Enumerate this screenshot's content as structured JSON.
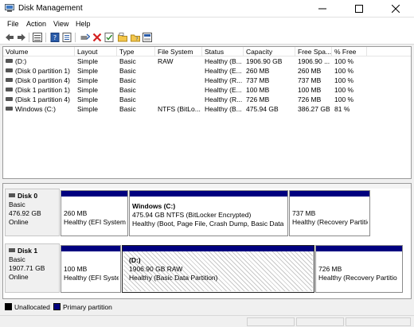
{
  "window": {
    "title": "Disk Management"
  },
  "menu": [
    "File",
    "Action",
    "View",
    "Help"
  ],
  "toolbar": {
    "icons": [
      "back-arrow-icon",
      "forward-arrow-icon",
      "list-view-icon",
      "help-book-icon",
      "properties-icon",
      "connect-icon",
      "delete-x-icon",
      "check-disk-icon",
      "new-folder-icon",
      "open-folder-icon",
      "toggle-view-icon"
    ]
  },
  "volume_list": {
    "columns": [
      "Volume",
      "Layout",
      "Type",
      "File System",
      "Status",
      "Capacity",
      "Free Spa...",
      "% Free"
    ],
    "rows": [
      [
        "(D:)",
        "Simple",
        "Basic",
        "RAW",
        "Healthy (B...",
        "1906.90 GB",
        "1906.90 ...",
        "100 %"
      ],
      [
        "(Disk 0 partition 1)",
        "Simple",
        "Basic",
        "",
        "Healthy (E...",
        "260 MB",
        "260 MB",
        "100 %"
      ],
      [
        "(Disk 0 partition 4)",
        "Simple",
        "Basic",
        "",
        "Healthy (R...",
        "737 MB",
        "737 MB",
        "100 %"
      ],
      [
        "(Disk 1 partition 1)",
        "Simple",
        "Basic",
        "",
        "Healthy (E...",
        "100 MB",
        "100 MB",
        "100 %"
      ],
      [
        "(Disk 1 partition 4)",
        "Simple",
        "Basic",
        "",
        "Healthy (R...",
        "726 MB",
        "726 MB",
        "100 %"
      ],
      [
        "Windows (C:)",
        "Simple",
        "Basic",
        "NTFS (BitLo...",
        "Healthy (B...",
        "475.94 GB",
        "386.27 GB",
        "81 %"
      ]
    ]
  },
  "disks": [
    {
      "name": "Disk 0",
      "type": "Basic",
      "size": "476.92 GB",
      "status": "Online",
      "partitions": [
        {
          "title": "",
          "line1": "260 MB",
          "line2": "Healthy (EFI System"
        },
        {
          "title": "Windows  (C:)",
          "line1": "475.94 GB NTFS (BitLocker Encrypted)",
          "line2": "Healthy (Boot, Page File, Crash Dump, Basic Data Par"
        },
        {
          "title": "",
          "line1": "737 MB",
          "line2": "Healthy (Recovery Partitio"
        }
      ]
    },
    {
      "name": "Disk 1",
      "type": "Basic",
      "size": "1907.71 GB",
      "status": "Online",
      "partitions": [
        {
          "title": "",
          "line1": "100 MB",
          "line2": "Healthy (EFI Syster"
        },
        {
          "title": "(D:)",
          "line1": "1906.90 GB RAW",
          "line2": "Healthy (Basic Data Partition)"
        },
        {
          "title": "",
          "line1": "726 MB",
          "line2": "Healthy (Recovery Partitio"
        }
      ]
    }
  ],
  "legend": [
    {
      "label": "Unallocated",
      "color": "#000000"
    },
    {
      "label": "Primary partition",
      "color": "#00007f"
    }
  ]
}
